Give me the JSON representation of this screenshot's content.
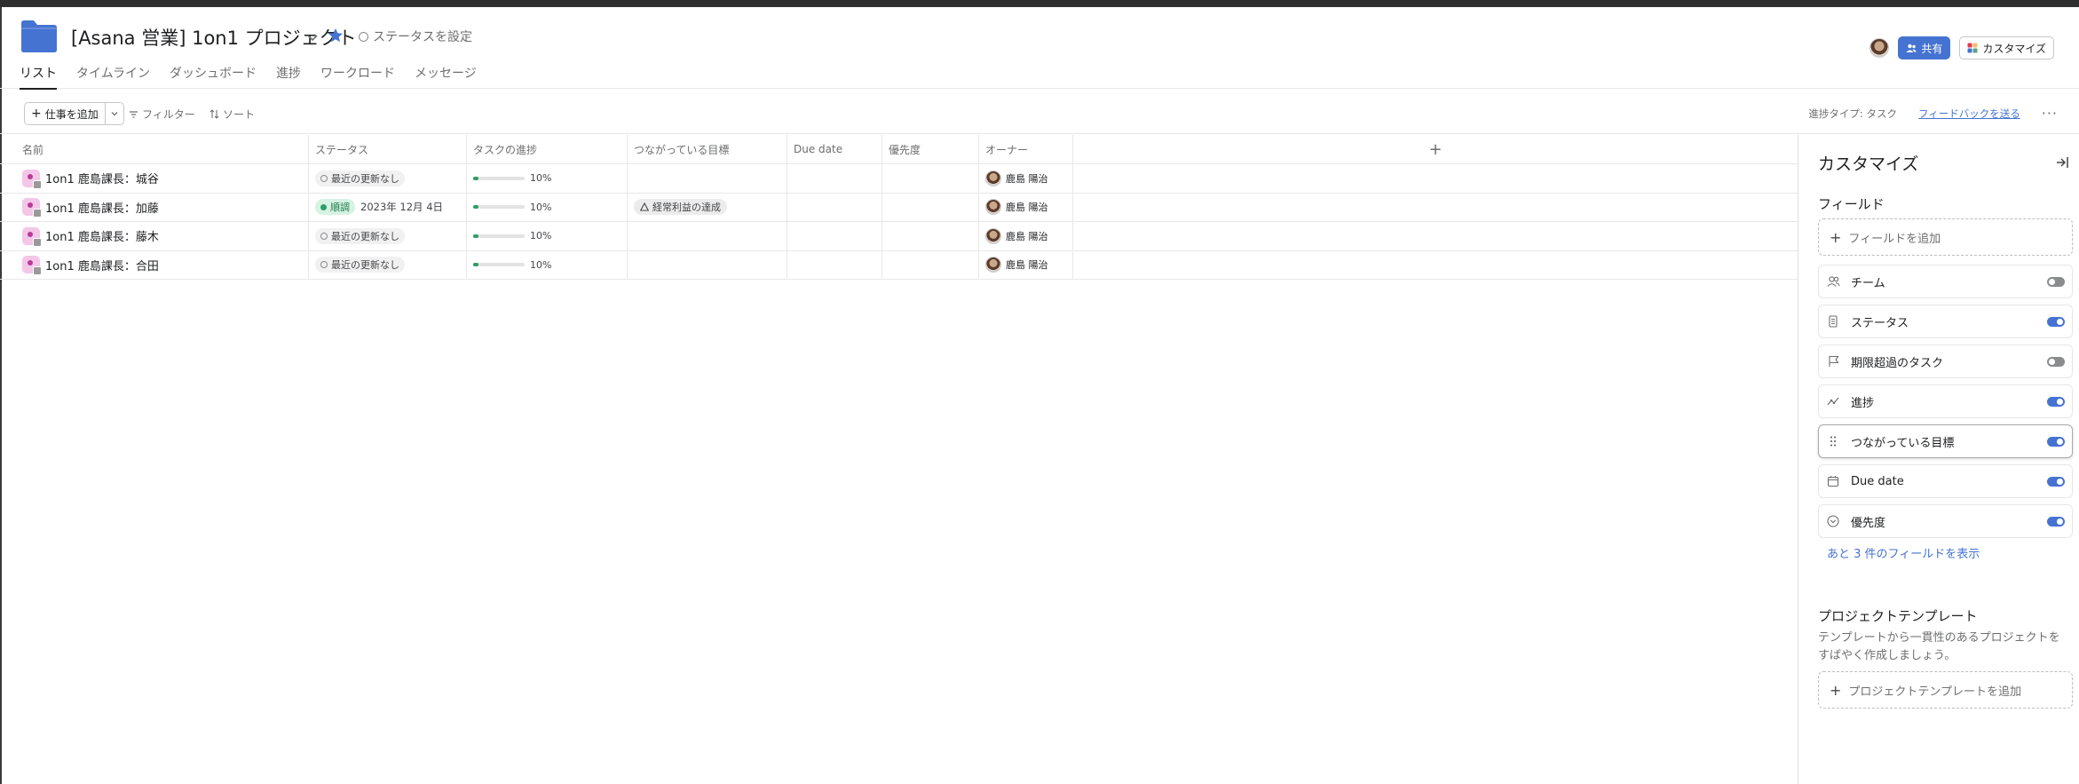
{
  "project": {
    "title": "[Asana 営業] 1on1 プロジェクト",
    "status_label": "ステータスを設定",
    "folder_color": "#4573d2"
  },
  "header": {
    "share_label": "共有",
    "customize_label": "カスタマイズ"
  },
  "tabs": [
    {
      "label": "リスト",
      "active": true
    },
    {
      "label": "タイムライン"
    },
    {
      "label": "ダッシュボード"
    },
    {
      "label": "進捗"
    },
    {
      "label": "ワークロード"
    },
    {
      "label": "メッセージ"
    }
  ],
  "toolbar": {
    "add_task_label": "仕事を追加",
    "filter_label": "フィルター",
    "sort_label": "ソート",
    "progress_type_label": "進捗タイプ: タスク",
    "feedback_label": "フィードバックを送る",
    "more_label": "···"
  },
  "table": {
    "columns": [
      "名前",
      "ステータス",
      "タスクの進捗",
      "つながっている目標",
      "Due date",
      "優先度",
      "オーナー"
    ],
    "add_column_label": "+",
    "rows": [
      {
        "name": "1on1 鹿島課長：城谷",
        "status": "最近の更新なし",
        "status_type": "none",
        "status_date": "",
        "progress": "10%",
        "progress_value": 0.1,
        "goal": "",
        "owner": "鹿島 陽治"
      },
      {
        "name": "1on1 鹿島課長：加藤",
        "status": "順調",
        "status_type": "on_track",
        "status_date": "2023年 12月 4日",
        "progress": "10%",
        "progress_value": 0.1,
        "goal": "経常利益の達成",
        "owner": "鹿島 陽治"
      },
      {
        "name": "1on1 鹿島課長：藤木",
        "status": "最近の更新なし",
        "status_type": "none",
        "status_date": "",
        "progress": "10%",
        "progress_value": 0.1,
        "goal": "",
        "owner": "鹿島 陽治"
      },
      {
        "name": "1on1 鹿島課長：合田",
        "status": "最近の更新なし",
        "status_type": "none",
        "status_date": "",
        "progress": "10%",
        "progress_value": 0.1,
        "goal": "",
        "owner": "鹿島 陽治"
      }
    ]
  },
  "panel": {
    "title": "カスタマイズ",
    "fields_section": "フィールド",
    "add_field_label": "フィールドを追加",
    "fields": [
      {
        "label": "チーム",
        "icon": "team-icon",
        "enabled": false
      },
      {
        "label": "ステータス",
        "icon": "status-icon",
        "enabled": true
      },
      {
        "label": "期限超過のタスク",
        "icon": "flag-icon",
        "enabled": false
      },
      {
        "label": "進捗",
        "icon": "progress-icon",
        "enabled": true
      },
      {
        "label": "つながっている目標",
        "icon": "drag-handle-icon",
        "enabled": true
      },
      {
        "label": "Due date",
        "icon": "calendar-icon",
        "enabled": true
      },
      {
        "label": "優先度",
        "icon": "priority-icon",
        "enabled": true
      }
    ],
    "more_fields_label": "あと 3 件のフィールドを表示",
    "template_section": "プロジェクトテンプレート",
    "template_desc": "テンプレートから一貫性のあるプロジェクトをすばやく作成しましょう。",
    "add_template_label": "プロジェクトテンプレートを追加"
  }
}
